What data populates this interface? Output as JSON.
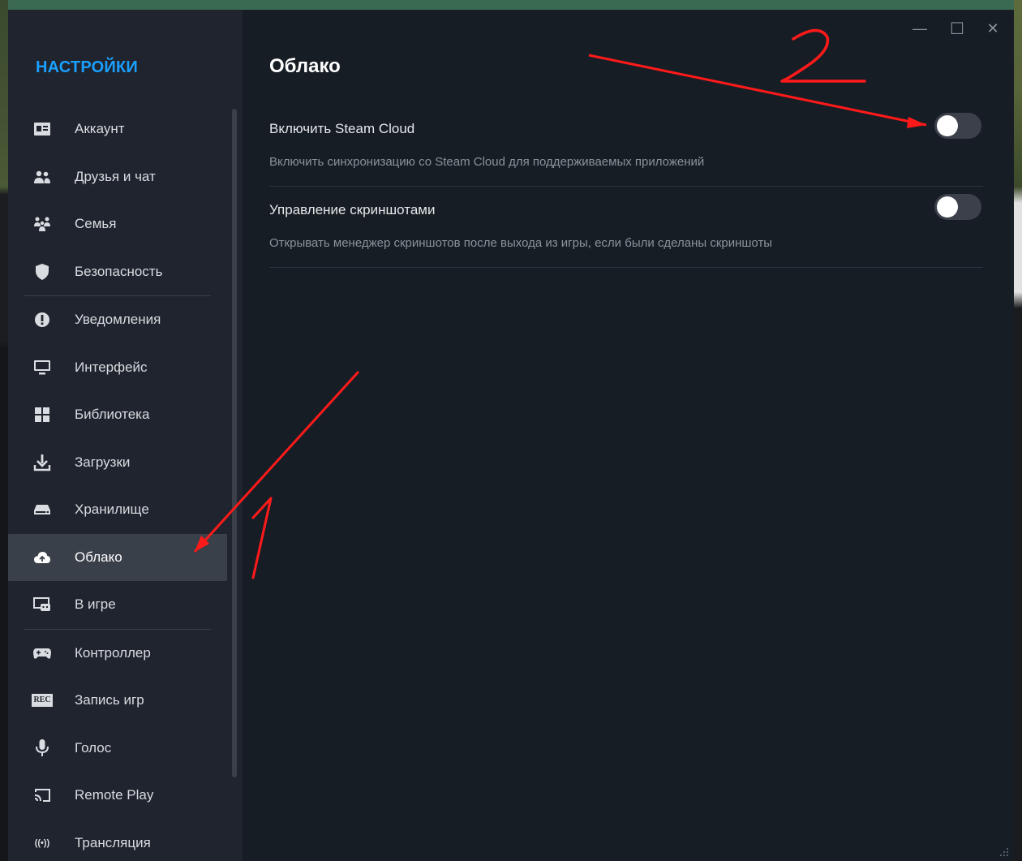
{
  "window": {
    "controls": {
      "minimize": "—",
      "maximize": "☐",
      "close": "✕"
    }
  },
  "sidebar": {
    "title": "НАСТРОЙКИ",
    "title_color": "#1a9fff",
    "items": [
      {
        "label": "Аккаунт",
        "icon": "account-card-icon"
      },
      {
        "label": "Друзья и чат",
        "icon": "friends-icon"
      },
      {
        "label": "Семья",
        "icon": "family-icon"
      },
      {
        "label": "Безопасность",
        "icon": "shield-icon"
      },
      {
        "label": "Уведомления",
        "icon": "alert-icon"
      },
      {
        "label": "Интерфейс",
        "icon": "monitor-icon"
      },
      {
        "label": "Библиотека",
        "icon": "grid-icon"
      },
      {
        "label": "Загрузки",
        "icon": "download-icon"
      },
      {
        "label": "Хранилище",
        "icon": "drive-icon"
      },
      {
        "label": "Облако",
        "icon": "cloud-icon",
        "active": true
      },
      {
        "label": "В игре",
        "icon": "in-game-icon"
      },
      {
        "label": "Контроллер",
        "icon": "gamepad-icon"
      },
      {
        "label": "Запись игр",
        "icon": "rec-icon",
        "icon_text": "REC"
      },
      {
        "label": "Голос",
        "icon": "microphone-icon"
      },
      {
        "label": "Remote Play",
        "icon": "cast-icon"
      },
      {
        "label": "Трансляция",
        "icon": "broadcast-icon",
        "icon_text": "((•))"
      }
    ]
  },
  "main": {
    "title": "Облако",
    "settings": [
      {
        "name": "Включить Steam Cloud",
        "description": "Включить синхронизацию со Steam Cloud для поддерживаемых приложений",
        "enabled": false
      },
      {
        "name": "Управление скриншотами",
        "description": "Открывать менеджер скриншотов после выхода из игры, если были сделаны скриншоты",
        "enabled": false
      }
    ]
  },
  "annotations": {
    "color": "#ff1a1a",
    "markers": [
      "1",
      "2"
    ]
  }
}
